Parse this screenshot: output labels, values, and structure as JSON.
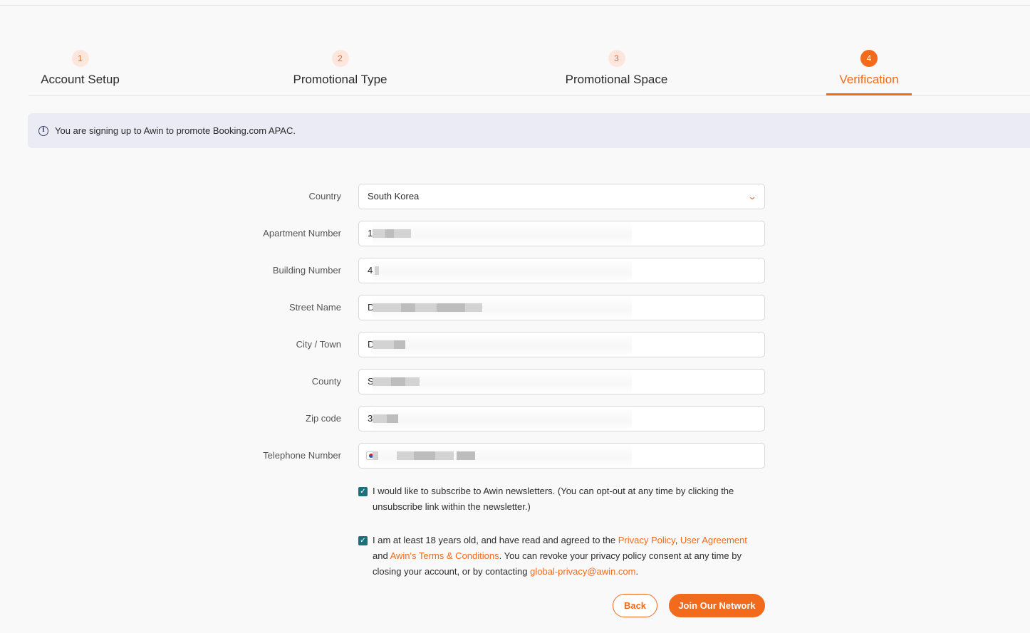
{
  "stepper": [
    {
      "number": "1",
      "label": "Account Setup"
    },
    {
      "number": "2",
      "label": "Promotional Type"
    },
    {
      "number": "3",
      "label": "Promotional Space"
    },
    {
      "number": "4",
      "label": "Verification"
    }
  ],
  "active_step": "4",
  "banner": {
    "icon": "info-icon",
    "text": "You are signing up to Awin to promote Booking.com APAC."
  },
  "form": {
    "country": {
      "label": "Country",
      "value": "South Korea"
    },
    "apartment_number": {
      "label": "Apartment Number",
      "value": "1"
    },
    "building_number": {
      "label": "Building Number",
      "value": "4"
    },
    "street_name": {
      "label": "Street Name",
      "value": "D"
    },
    "city_town": {
      "label": "City / Town",
      "value": "D"
    },
    "county": {
      "label": "County",
      "value": "S"
    },
    "zip_code": {
      "label": "Zip code",
      "value": "3"
    },
    "telephone": {
      "label": "Telephone Number",
      "flag": "south-korea-flag-icon"
    }
  },
  "newsletter": {
    "checked": true,
    "text": "I would like to subscribe to Awin newsletters. (You can opt-out at any time by clicking the unsubscribe link within the newsletter.)"
  },
  "consent": {
    "checked": true,
    "text_1": "I am at least 18 years old, and have read and agreed to the ",
    "privacy_policy": "Privacy Policy",
    "sep": ", ",
    "user_agreement": "User Agreement",
    "and": " and ",
    "terms": "Awin's Terms & Conditions",
    "text_2": ". You can revoke your privacy policy consent at any time by closing your account, or by contacting ",
    "email": "global-privacy@awin.com",
    "end": "."
  },
  "buttons": {
    "back": "Back",
    "join": "Join Our Network"
  },
  "colors": {
    "accent": "#f26a1b",
    "banner_bg": "#ebebf6",
    "checkbox": "#1d6f7a"
  }
}
